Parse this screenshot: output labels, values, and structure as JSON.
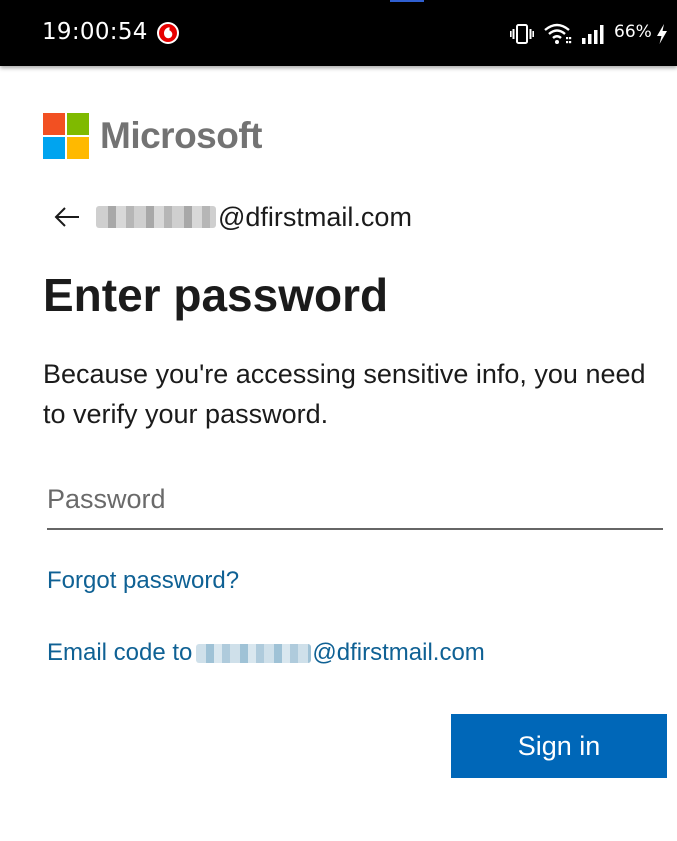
{
  "status_bar": {
    "time": "19:00:54",
    "battery_percent": "66%",
    "icons": [
      "vodafone-icon",
      "vibrate-icon",
      "wifi-icon",
      "cell-signal-icon",
      "charging-icon"
    ]
  },
  "brand": {
    "name": "Microsoft",
    "logo_colors": [
      "#f25022",
      "#7fba00",
      "#00a4ef",
      "#ffb900"
    ]
  },
  "identity": {
    "email_domain": "@dfirstmail.com"
  },
  "page": {
    "title": "Enter password",
    "description": "Because you're accessing sensitive info, you need to verify your password."
  },
  "password_field": {
    "placeholder": "Password",
    "value": ""
  },
  "links": {
    "forgot_password": "Forgot password?",
    "email_code_prefix": "Email code to",
    "email_code_domain": "@dfirstmail.com"
  },
  "actions": {
    "sign_in_label": "Sign in"
  },
  "colors": {
    "primary_button": "#0067b8",
    "link": "#0f6194",
    "status_bar": "#000000"
  }
}
